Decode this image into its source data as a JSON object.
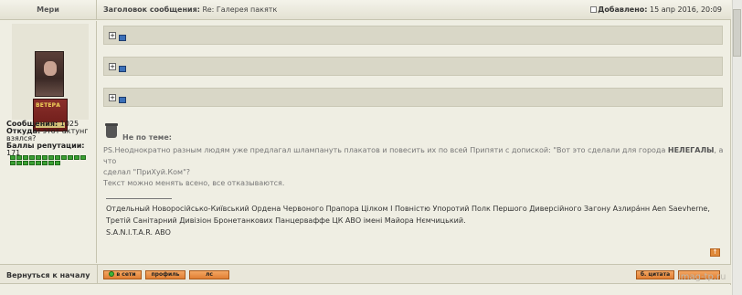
{
  "header": {
    "author_col": "Мери",
    "subject_prefix": "Заголовок сообщения:",
    "subject": "Re: Галерея пакятк",
    "date_prefix": "Добавлено:",
    "date": "15 апр 2016, 20:09"
  },
  "user": {
    "messages_label": "Сообщения:",
    "messages_value": "1025",
    "from_label": "Откуда:",
    "from_value_1": "этот актунг",
    "from_value_2": "взялся?",
    "rep_label": "Баллы репутации:",
    "rep_value": "171",
    "rep_pips": 20,
    "avatar_banner_text": "ВЕТЕРА"
  },
  "post": {
    "quote_count": 3,
    "quote_expand_symbol": "+",
    "offtopic_label": "Не по теме:",
    "text_1": "PS.Неоднократно разным людям уже предлагал шлампануть плакатов и повесить их по всей Припяти с допиской: \"Вот это сделали для города ",
    "text_1_bold": "НЕЛЕГАЛЫ",
    "text_1_end": ", а что",
    "text_2": "сделал \"ПриХуй.Ком\"?",
    "text_3": "Текст можно менять всено, все отказываются.",
    "signature_1": "Отдельный Новоросійсько-Київський Ордена Червоного Прапора Цілком І Повністю Упоротий Полк Першого Диверсійного Загону Азлирáнн Aen Saevherne,",
    "signature_2": "Третій Санітарний Дивізіон Бронетанкових Панцерваффе ЦК АВО імені Майора Нємчицький.",
    "signature_3": "S.A.N.I.T.A.R. АВО",
    "up_symbol": "↑"
  },
  "footer": {
    "back_to_top": "Вернуться к началу",
    "online_label": "в сети",
    "profile_label": "профиль",
    "pm_label": "лс",
    "quote_label": "б. цитата",
    "watermark": "imag-tp.ru"
  }
}
